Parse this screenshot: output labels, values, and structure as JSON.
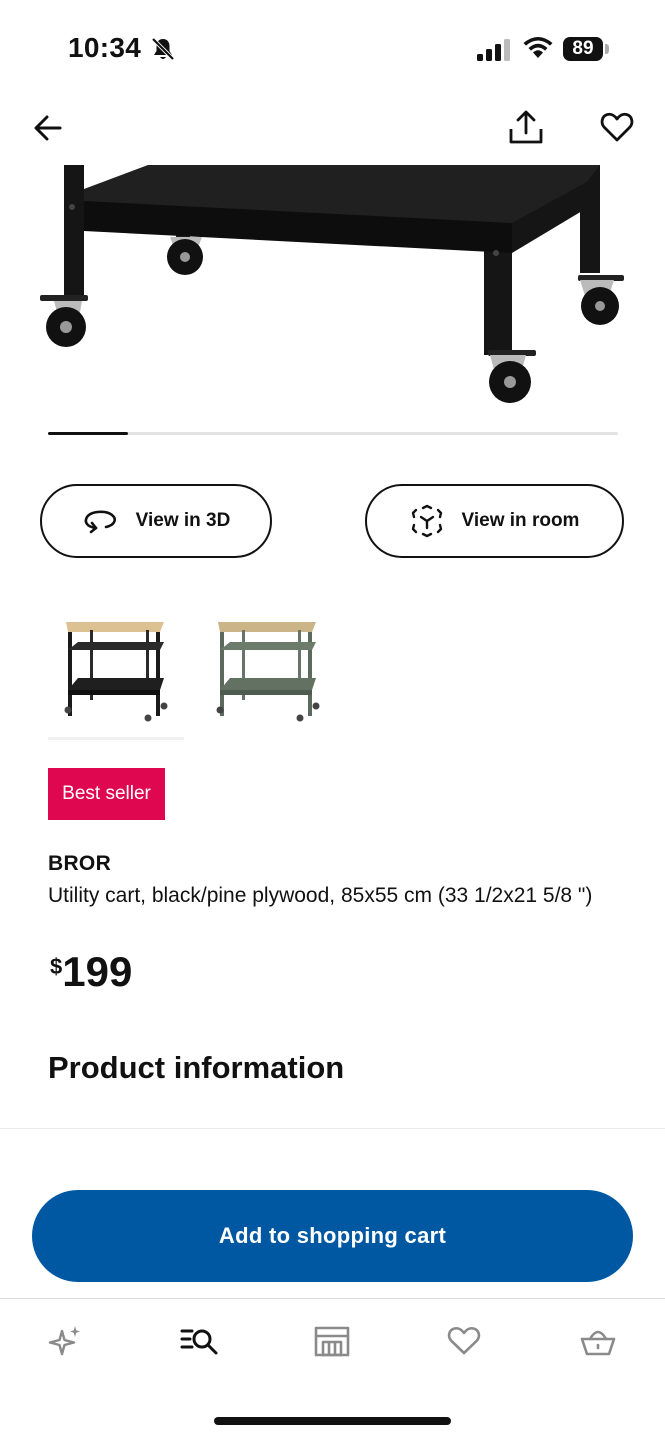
{
  "status_bar": {
    "time": "10:34",
    "battery": "89"
  },
  "media": {
    "image_progress": 0.14
  },
  "actions": {
    "view_3d": "View in 3D",
    "view_room": "View in room"
  },
  "badge": "Best seller",
  "product": {
    "name": "BROR",
    "description": "Utility cart, black/pine plywood, 85x55 cm (33 1/2x21 5/8 \")",
    "price_currency": "$",
    "price_amount": "199"
  },
  "section_title": "Product information",
  "cta_label": "Add to shopping cart",
  "tabs": [
    {
      "icon": "sparkle-icon"
    },
    {
      "icon": "search-list-icon",
      "active": true
    },
    {
      "icon": "store-icon"
    },
    {
      "icon": "heart-icon"
    },
    {
      "icon": "basket-icon"
    }
  ],
  "colors": {
    "brand_blue": "#0058a3",
    "badge_red": "#e00751"
  }
}
